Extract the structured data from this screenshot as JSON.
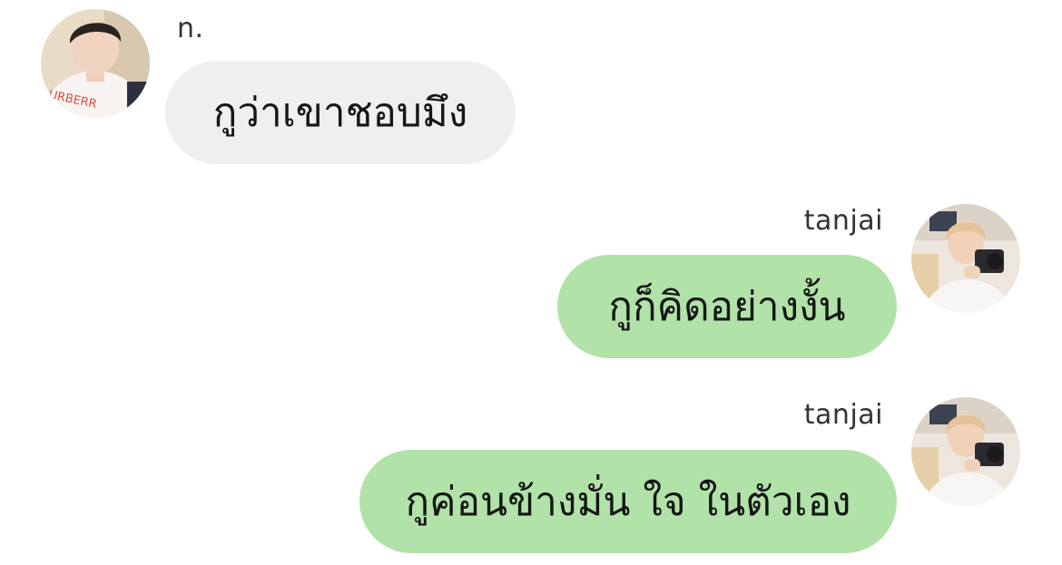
{
  "messages": [
    {
      "sender": "n.",
      "direction": "incoming",
      "text": "กูว่าเขาชอบมึง",
      "avatar_icon": "profile-photo"
    },
    {
      "sender": "tanjai",
      "direction": "outgoing",
      "text": "กูก็คิดอย่างงั้น",
      "avatar_icon": "profile-photo"
    },
    {
      "sender": "tanjai",
      "direction": "outgoing",
      "text": "กูค่อนข้างมั่น ใจ ในตัวเอง",
      "avatar_icon": "profile-photo"
    }
  ],
  "colors": {
    "incoming_bubble": "#efefef",
    "outgoing_bubble": "#b1e3a8",
    "text": "#161616",
    "sender_name": "#333333"
  }
}
